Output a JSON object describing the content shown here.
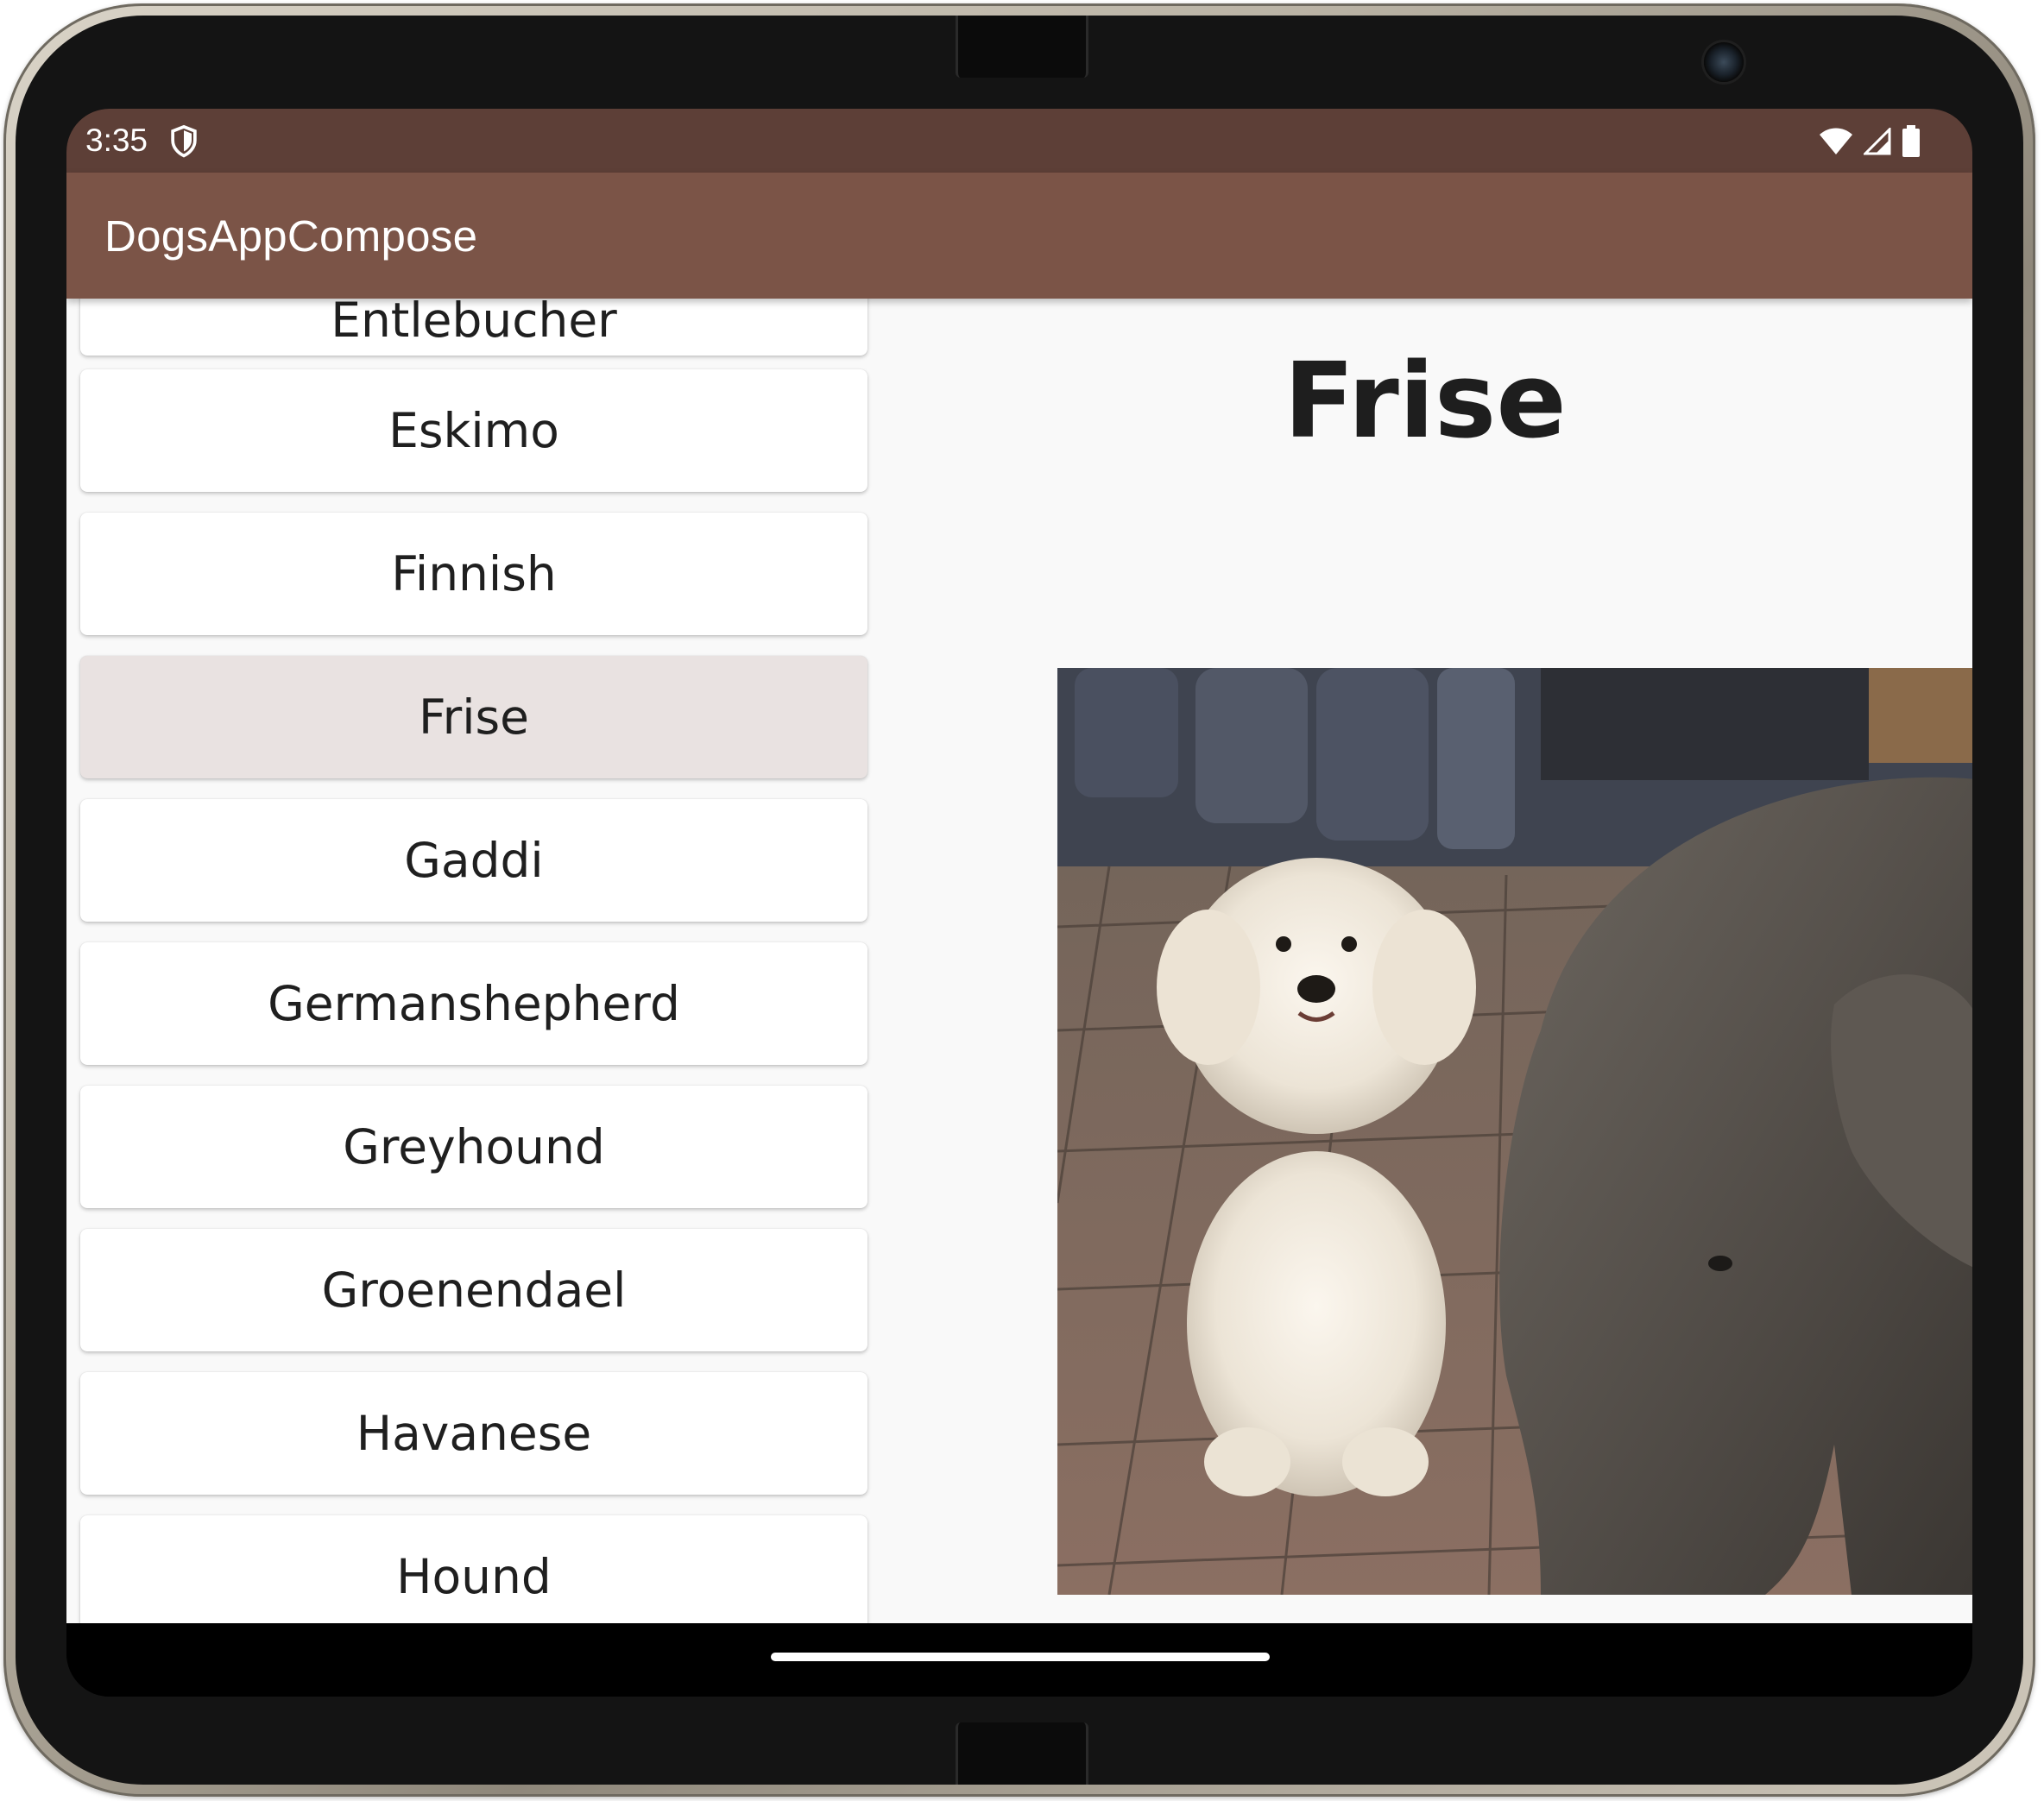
{
  "status_bar": {
    "time": "3:35",
    "icons": [
      "shield-icon",
      "wifi-icon",
      "cellular-signal-icon",
      "battery-icon"
    ]
  },
  "app_bar": {
    "title": "DogsAppCompose"
  },
  "breed_list": {
    "items": [
      {
        "label": "Entlebucher",
        "selected": false
      },
      {
        "label": "Eskimo",
        "selected": false
      },
      {
        "label": "Finnish",
        "selected": false
      },
      {
        "label": "Frise",
        "selected": true
      },
      {
        "label": "Gaddi",
        "selected": false
      },
      {
        "label": "Germanshepherd",
        "selected": false
      },
      {
        "label": "Greyhound",
        "selected": false
      },
      {
        "label": "Groenendael",
        "selected": false
      },
      {
        "label": "Havanese",
        "selected": false
      },
      {
        "label": "Hound",
        "selected": false
      }
    ]
  },
  "detail": {
    "title": "Frise",
    "image": "photo of a white bichon frise puppy next to a grey elephant statue on a brick pavement"
  },
  "colors": {
    "status_bar": "#5d3f37",
    "app_bar": "#7b5447",
    "selected_item": "#e9e2e1",
    "background": "#f9f9f9"
  }
}
